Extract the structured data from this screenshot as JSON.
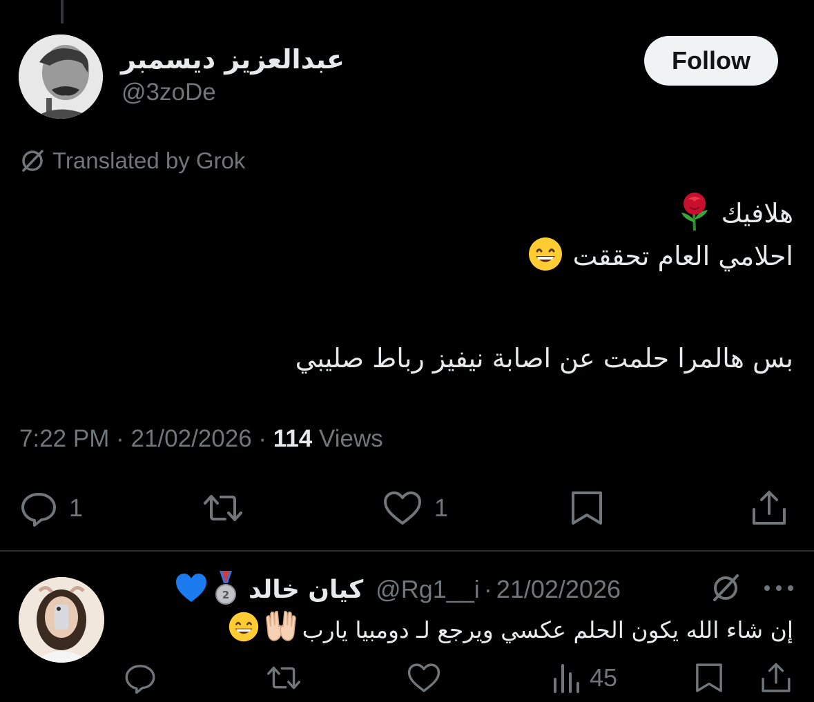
{
  "tweet": {
    "author_name": "عبدالعزيز ديسمبر",
    "author_handle": "@3zoDe",
    "follow_label": "Follow",
    "translated_label": "Translated by Grok",
    "text_lines": [
      "هلافيك",
      "احلامي العام تحققت",
      "بس هالمرا حلمت عن اصابة نيفيز رباط صليبي"
    ],
    "line_emojis": [
      "rose-emoji",
      "grinning-face-emoji"
    ],
    "time": "7:22 PM",
    "date": "21/02/2026",
    "views_count": "114",
    "views_label": "Views",
    "actions": {
      "reply_count": "1",
      "retweet_count": "",
      "like_count": "1"
    }
  },
  "reply": {
    "author_name": "كيان خالد",
    "badges": [
      "silver-medal-emoji",
      "blue-heart-emoji"
    ],
    "handle": "@Rg1__i",
    "separator": "·",
    "date": "21/02/2026",
    "text": "إن شاء الله يكون الحلم عكسي ويرجع لـ دومبيا يارب",
    "text_emojis": [
      "raising-hands-emoji",
      "grinning-face-emoji"
    ],
    "actions": {
      "views_count": "45"
    }
  },
  "colors": {
    "background": "#000000",
    "text_primary": "#e7e9ea",
    "text_secondary": "#71767b",
    "divider": "#2f3336",
    "follow_bg": "#eff3f4"
  }
}
